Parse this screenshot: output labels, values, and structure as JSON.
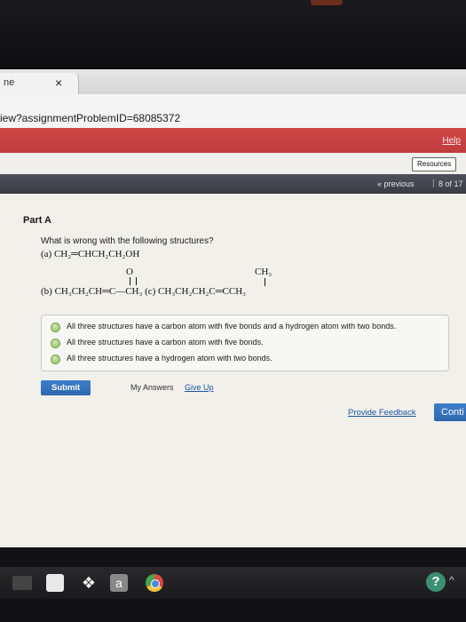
{
  "browser": {
    "tab_title": "ne",
    "tab_close": "×",
    "url": "iew?assignmentProblemID=68085372",
    "minimize": "–"
  },
  "header": {
    "help_label": "Help",
    "resources_label": "Resources",
    "previous_label": "« previous",
    "separator": "|",
    "page_count": "8 of 17"
  },
  "problem": {
    "part_title": "Part A",
    "question": "What is wrong with the following structures?",
    "structure_a": "(a) CH₂═CHCH₂CH₂OH",
    "structure_b": "(b) CH₃CH₂CH═C—CH₃ (c) CH₃CH₂CH₂C═CCH₃",
    "o_label": "O",
    "ch3_label": "CH₃"
  },
  "options": [
    "All three structures have a carbon atom with five bonds and a hydrogen atom with two bonds.",
    "All three structures have a carbon atom with five bonds.",
    "All three structures have a hydrogen atom with two bonds."
  ],
  "actions": {
    "submit_label": "Submit",
    "my_answers_label": "My Answers",
    "give_up_label": "Give Up",
    "feedback_label": "Provide Feedback",
    "continue_label": "Conti"
  },
  "taskbar": {
    "amazon_icon_text": "a",
    "help_icon_text": "?",
    "caret": "^"
  },
  "colors": {
    "accent_red": "#c84242",
    "button_blue": "#3273be",
    "link_blue": "#1c55a6",
    "radio_green": "#8fbf5a"
  }
}
